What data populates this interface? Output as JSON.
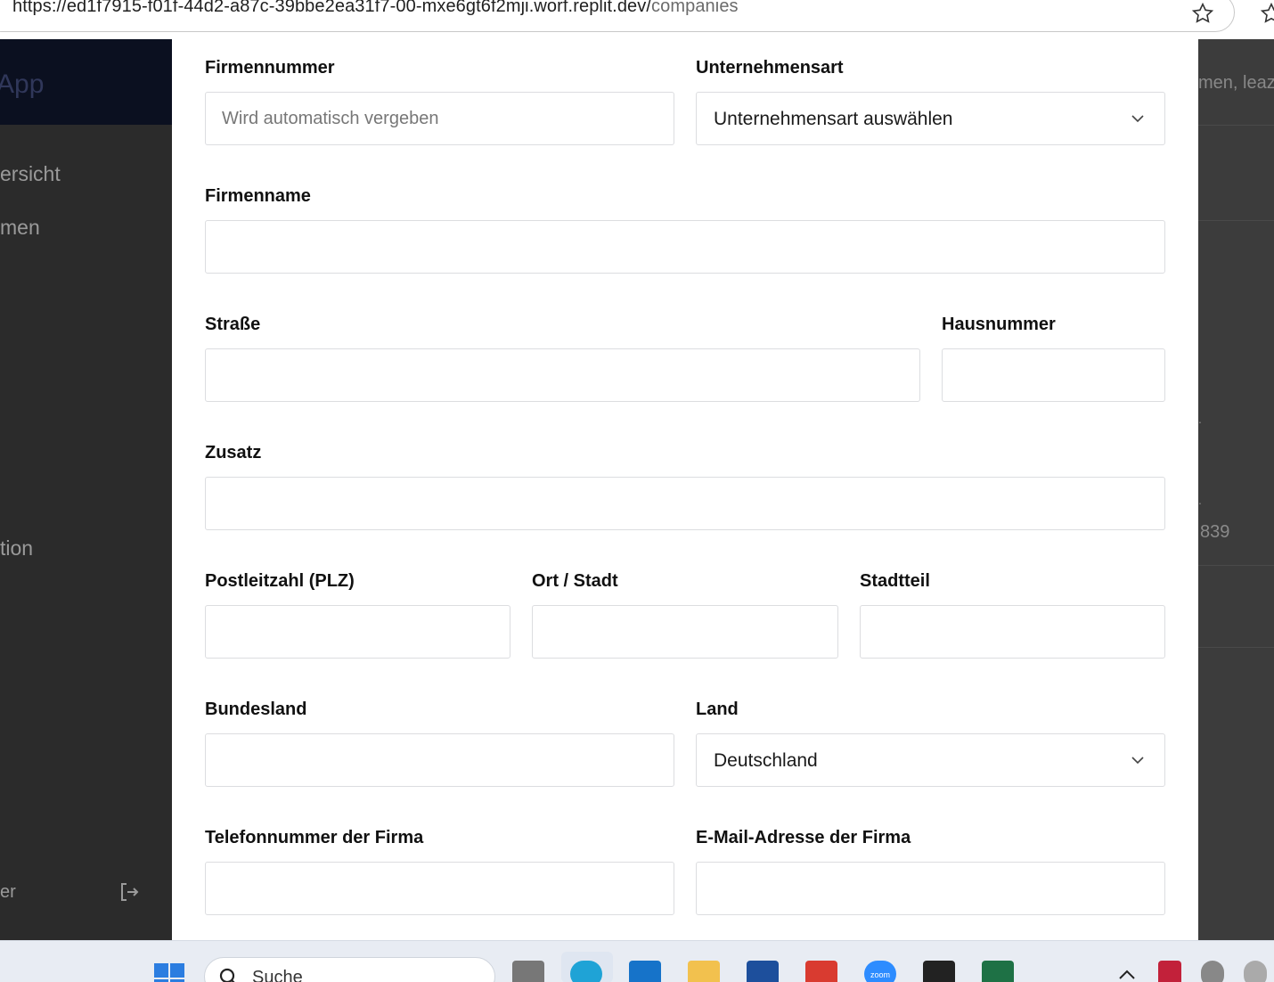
{
  "browser": {
    "url_main": "https://ed1f7915-f01f-44d2-a87c-39bbe2ea31f7-00-mxe6gt6f2mji.worf.replit.dev/",
    "url_path": "companies"
  },
  "backdrop": {
    "brand": "App",
    "sidebar_items": [
      "ersicht",
      "men",
      "tion"
    ],
    "sidebar_footer": "er",
    "right_header": "men, leaz",
    "right_number": "839",
    "right_dot": "."
  },
  "form": {
    "firmennummer": {
      "label": "Firmennummer",
      "placeholder": "Wird automatisch vergeben"
    },
    "unternehmensart": {
      "label": "Unternehmensart",
      "value": "Unternehmensart auswählen"
    },
    "firmenname": {
      "label": "Firmenname",
      "value": ""
    },
    "strasse": {
      "label": "Straße",
      "value": ""
    },
    "hausnummer": {
      "label": "Hausnummer",
      "value": ""
    },
    "zusatz": {
      "label": "Zusatz",
      "value": ""
    },
    "plz": {
      "label": "Postleitzahl (PLZ)",
      "value": ""
    },
    "ort": {
      "label": "Ort / Stadt",
      "value": ""
    },
    "stadtteil": {
      "label": "Stadtteil",
      "value": ""
    },
    "bundesland": {
      "label": "Bundesland",
      "value": ""
    },
    "land": {
      "label": "Land",
      "value": "Deutschland"
    },
    "telefon": {
      "label": "Telefonnummer der Firma",
      "value": ""
    },
    "email": {
      "label": "E-Mail-Adresse der Firma",
      "value": ""
    }
  },
  "taskbar": {
    "search_label": "Suche",
    "zoom_label": "zoom"
  },
  "colors": {
    "modal_bg": "#ffffff",
    "border": "#dcdde0",
    "sidebar_dark": "#0b1020",
    "overlay": "#3a3a3a"
  }
}
